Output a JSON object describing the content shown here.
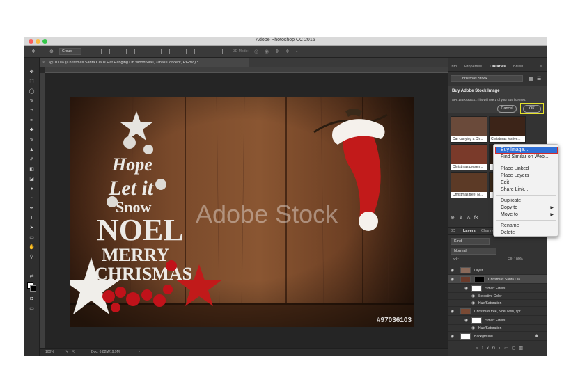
{
  "window": {
    "title": "Adobe Photoshop CC 2015"
  },
  "options_bar": {
    "group_label": "Group",
    "mode3d_label": "3D Mode:"
  },
  "document": {
    "tab_label": "@ 100% (Christmas Santa Claus Hat Hanging On Wood Wall, Xmas Concept, RGB/8) *",
    "close_glyph": "×"
  },
  "canvas": {
    "watermark": "Adobe Stock",
    "stock_id": "#97036103",
    "tree_words": [
      "Hope",
      "Let it",
      "Snow",
      "NOEL",
      "MERRY",
      "CHRISMAS"
    ]
  },
  "status": {
    "zoom": "100%",
    "doc_size": "Doc: 6.82M/19.9M"
  },
  "right_panel": {
    "tabs": [
      "Info",
      "Properties",
      "Libraries",
      "Brush"
    ],
    "active_tab": "Libraries",
    "library_name": "Christmas Stock",
    "buy_title": "Buy Adobe Stock Image",
    "buy_text": "API::LIBRARIES::This will use 1 of your 449 licenses.",
    "cancel_label": "Cancel",
    "ok_label": "OK",
    "thumbs": [
      "Car carrying a Ch...",
      "Christmas festive...",
      "Christmas presen...",
      "",
      "Christmas tree, N...",
      ""
    ]
  },
  "layers_panel": {
    "tabs": [
      "3D",
      "Layers",
      "Channels"
    ],
    "active_tab": "Layers",
    "kind_label": "Kind",
    "blend_mode": "Normal",
    "lock_label": "Lock:",
    "fill_label": "Fill: 100%",
    "layers": [
      {
        "name": "Layer 1"
      },
      {
        "name": "Christmas Santa Cla..."
      },
      {
        "name": "Smart Filters"
      },
      {
        "name": "Selective Color"
      },
      {
        "name": "Hue/Saturation"
      },
      {
        "name": "Christmas tree, Noel wish, spr..."
      },
      {
        "name": "Smart Filters"
      },
      {
        "name": "Hue/Saturation"
      },
      {
        "name": "Background"
      }
    ]
  },
  "context_menu": {
    "items": [
      "Buy Image...",
      "Find Similar on Web...",
      "Place Linked",
      "Place Layers",
      "Edit",
      "Share Link...",
      "Duplicate",
      "Copy to",
      "Move to",
      "Rename",
      "Delete"
    ],
    "selected": "Buy Image...",
    "submenu_glyph": "▶"
  }
}
